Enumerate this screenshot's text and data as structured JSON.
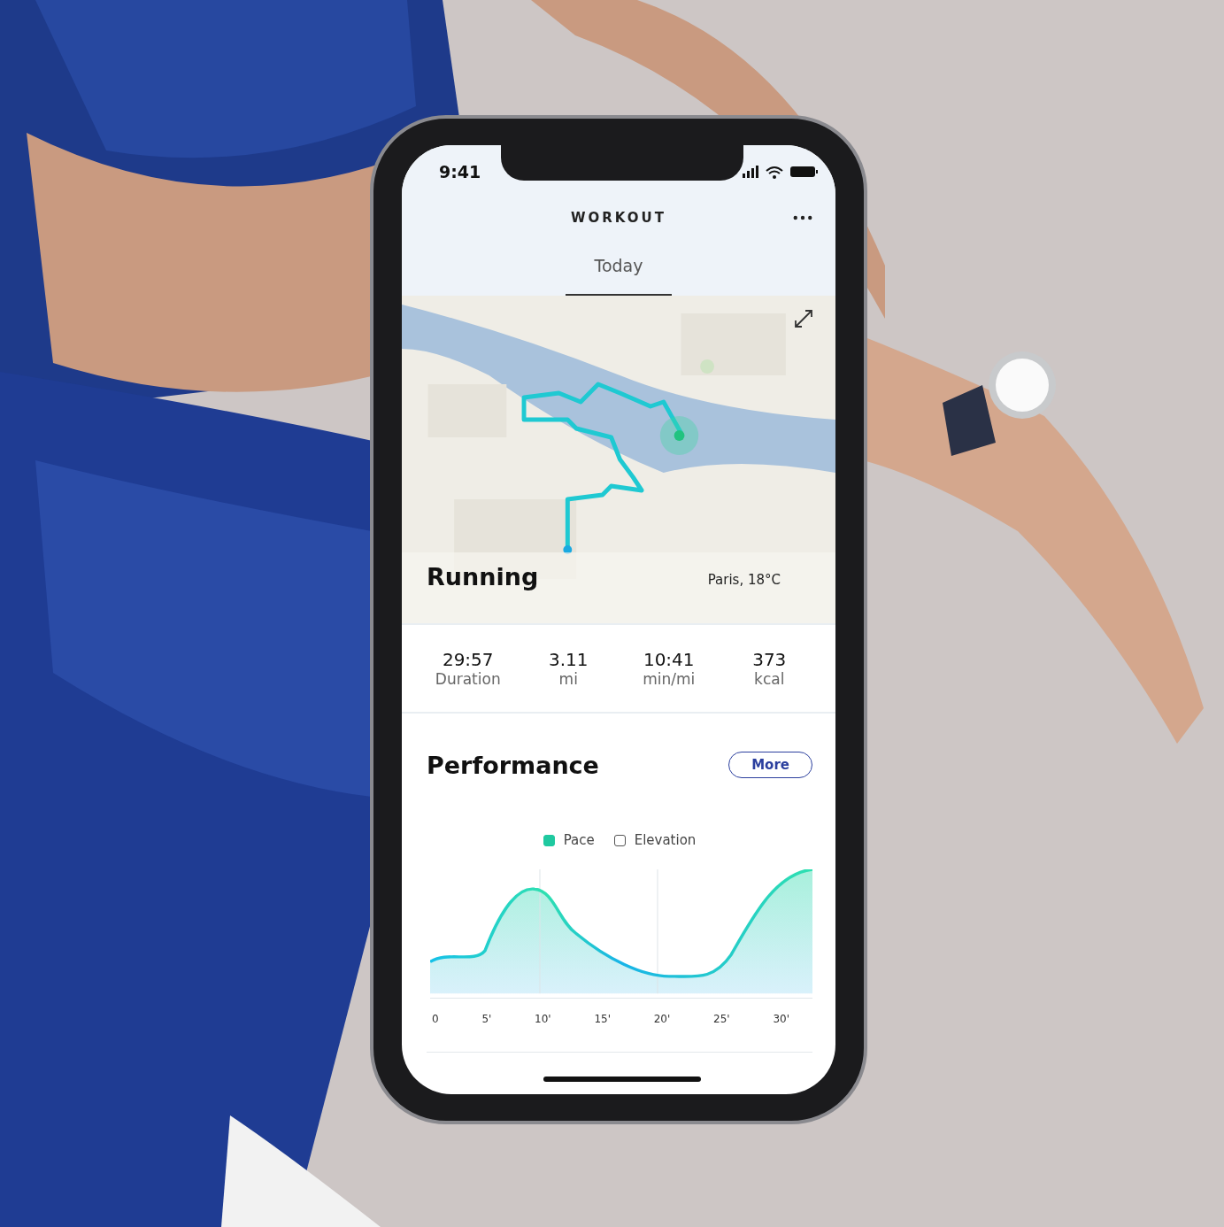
{
  "status_bar": {
    "time": "9:41"
  },
  "header": {
    "title": "WORKOUT"
  },
  "tabs": [
    {
      "label": "Today",
      "selected": true
    }
  ],
  "map": {
    "activity": "Running",
    "location": "Paris, 18°C"
  },
  "stats": [
    {
      "value": "29:57",
      "label": "Duration"
    },
    {
      "value": "3.11",
      "label": "mi"
    },
    {
      "value": "10:41",
      "label": "min/mi"
    },
    {
      "value": "373",
      "label": "kcal"
    }
  ],
  "performance": {
    "title": "Performance",
    "button": "More",
    "legend": [
      {
        "label": "Pace",
        "checked": true
      },
      {
        "label": "Elevation",
        "checked": false
      }
    ],
    "x_ticks": [
      "0",
      "5'",
      "10'",
      "15'",
      "20'",
      "25'",
      "30'"
    ]
  }
}
